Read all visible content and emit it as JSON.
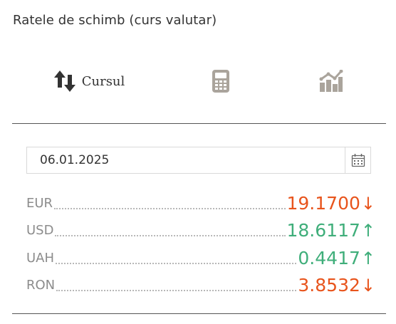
{
  "widget": {
    "title": "Ratele de schimb (curs valutar)"
  },
  "tabs": [
    {
      "id": "rates",
      "label": "Cursul",
      "icon": "up-down-arrows-icon"
    },
    {
      "id": "calculator",
      "label": "",
      "icon": "calculator-icon"
    },
    {
      "id": "chart",
      "label": "",
      "icon": "bar-chart-icon"
    }
  ],
  "date_picker": {
    "value": "06.01.2025",
    "icon": "calendar-icon"
  },
  "rates": [
    {
      "code": "EUR",
      "value": "19.1700",
      "trend": "↓",
      "color": "#e8541c"
    },
    {
      "code": "USD",
      "value": "18.6117",
      "trend": "↑",
      "color": "#3fae7a"
    },
    {
      "code": "UAH",
      "value": "0.4417",
      "trend": "↑",
      "color": "#3fae7a"
    },
    {
      "code": "RON",
      "value": "3.8532",
      "trend": "↓",
      "color": "#e8541c"
    }
  ],
  "colors": {
    "down": "#e8541c",
    "up": "#3fae7a",
    "muted_icon": "#aaa49c",
    "dark_icon": "#333333"
  }
}
